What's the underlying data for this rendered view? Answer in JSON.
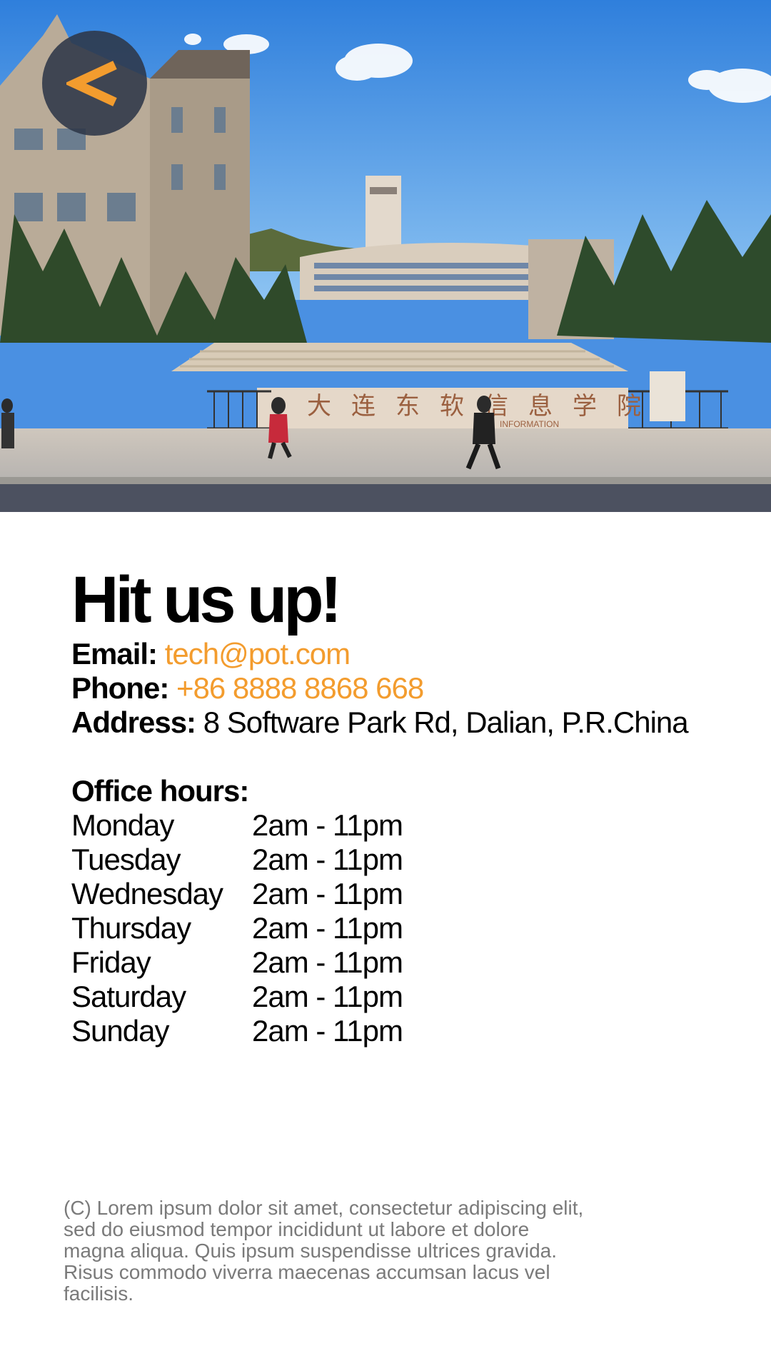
{
  "nav": {
    "back_icon": "chevron-left-icon",
    "accent_color": "#f39c2e"
  },
  "hero": {
    "image": "university-campus-photo",
    "sign_text": "大连东软信息学院",
    "sign_subtext": "INFORMATION"
  },
  "contact": {
    "title": "Hit us up!",
    "email_label": "Email:",
    "email_value": "tech@pot.com",
    "phone_label": "Phone:",
    "phone_value": "+86 8888 8868 668",
    "address_label": "Address:",
    "address_value": "8 Software Park Rd, Dalian, P.R.China"
  },
  "office_hours": {
    "title": "Office hours:",
    "days": [
      {
        "day": "Monday",
        "hours": "2am - 11pm"
      },
      {
        "day": "Tuesday",
        "hours": "2am - 11pm"
      },
      {
        "day": "Wednesday",
        "hours": "2am - 11pm"
      },
      {
        "day": "Thursday",
        "hours": "2am - 11pm"
      },
      {
        "day": "Friday",
        "hours": "2am - 11pm"
      },
      {
        "day": "Saturday",
        "hours": "2am - 11pm"
      },
      {
        "day": "Sunday",
        "hours": "2am - 11pm"
      }
    ]
  },
  "footer": {
    "text": "(C) Lorem ipsum dolor sit amet, consectetur adipiscing elit, sed do eiusmod tempor incididunt ut labore et dolore magna aliqua. Quis ipsum suspendisse ultrices gravida. Risus commodo viverra maecenas accumsan lacus vel facilisis."
  }
}
